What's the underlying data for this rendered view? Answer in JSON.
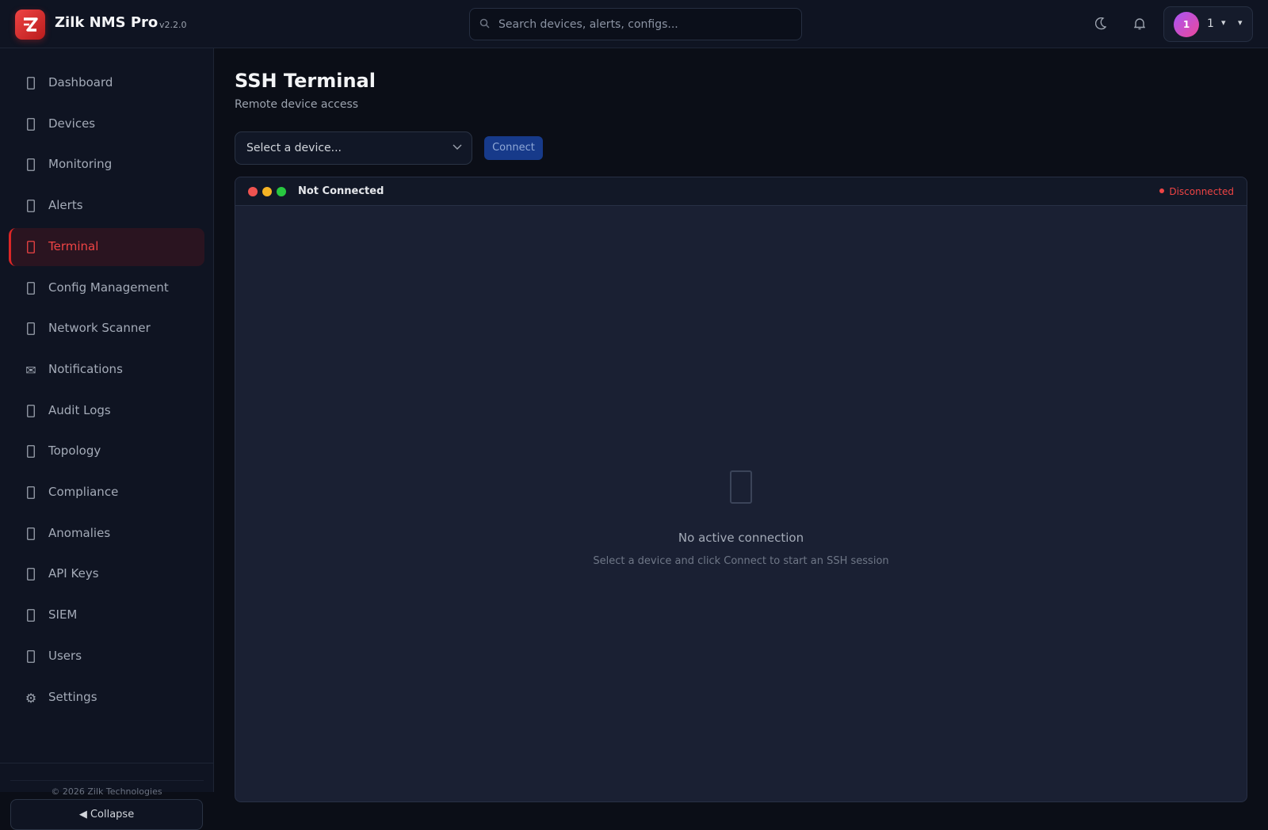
{
  "header": {
    "app_name": "Zilk NMS Pro",
    "version": "v2.2.0",
    "search_placeholder": "Search devices, alerts, configs...",
    "user": {
      "avatar_initial": "1",
      "name": "1",
      "caret": "▾",
      "chevron": "▾"
    }
  },
  "sidebar": {
    "items": [
      {
        "label": "Dashboard",
        "icon": "dashboard-icon"
      },
      {
        "label": "Devices",
        "icon": "server-icon"
      },
      {
        "label": "Monitoring",
        "icon": "monitor-icon"
      },
      {
        "label": "Alerts",
        "icon": "bell-icon"
      },
      {
        "label": "Terminal",
        "icon": "terminal-icon",
        "active": true
      },
      {
        "label": "Config Management",
        "icon": "file-icon"
      },
      {
        "label": "Network Scanner",
        "icon": "radar-icon"
      },
      {
        "label": "Notifications",
        "icon": "envelope-icon",
        "glyph": "✉"
      },
      {
        "label": "Audit Logs",
        "icon": "clipboard-icon"
      },
      {
        "label": "Topology",
        "icon": "network-icon"
      },
      {
        "label": "Compliance",
        "icon": "shield-icon"
      },
      {
        "label": "Anomalies",
        "icon": "chart-icon"
      },
      {
        "label": "API Keys",
        "icon": "key-icon"
      },
      {
        "label": "SIEM",
        "icon": "lock-icon"
      },
      {
        "label": "Users",
        "icon": "users-icon"
      },
      {
        "label": "Settings",
        "icon": "gear-icon",
        "glyph": "⚙"
      }
    ],
    "copyright": "© 2026 Zilk Technologies",
    "collapse_label": "◀  Collapse"
  },
  "main": {
    "title": "SSH Terminal",
    "subtitle": "Remote device access",
    "device_select": {
      "value": "Select a device...",
      "options": [
        "Select a device..."
      ]
    },
    "connect_label": "Connect",
    "terminal": {
      "title": "Not Connected",
      "status": "Disconnected",
      "empty_title": "No active connection",
      "empty_subtitle": "Select a device and click Connect to start an SSH session"
    }
  },
  "colors": {
    "accent": "#dc2626",
    "window_close": "#ef5350",
    "window_minimize": "#f5b324",
    "window_maximize": "#28c840",
    "status_disconnected": "#ef4444"
  }
}
